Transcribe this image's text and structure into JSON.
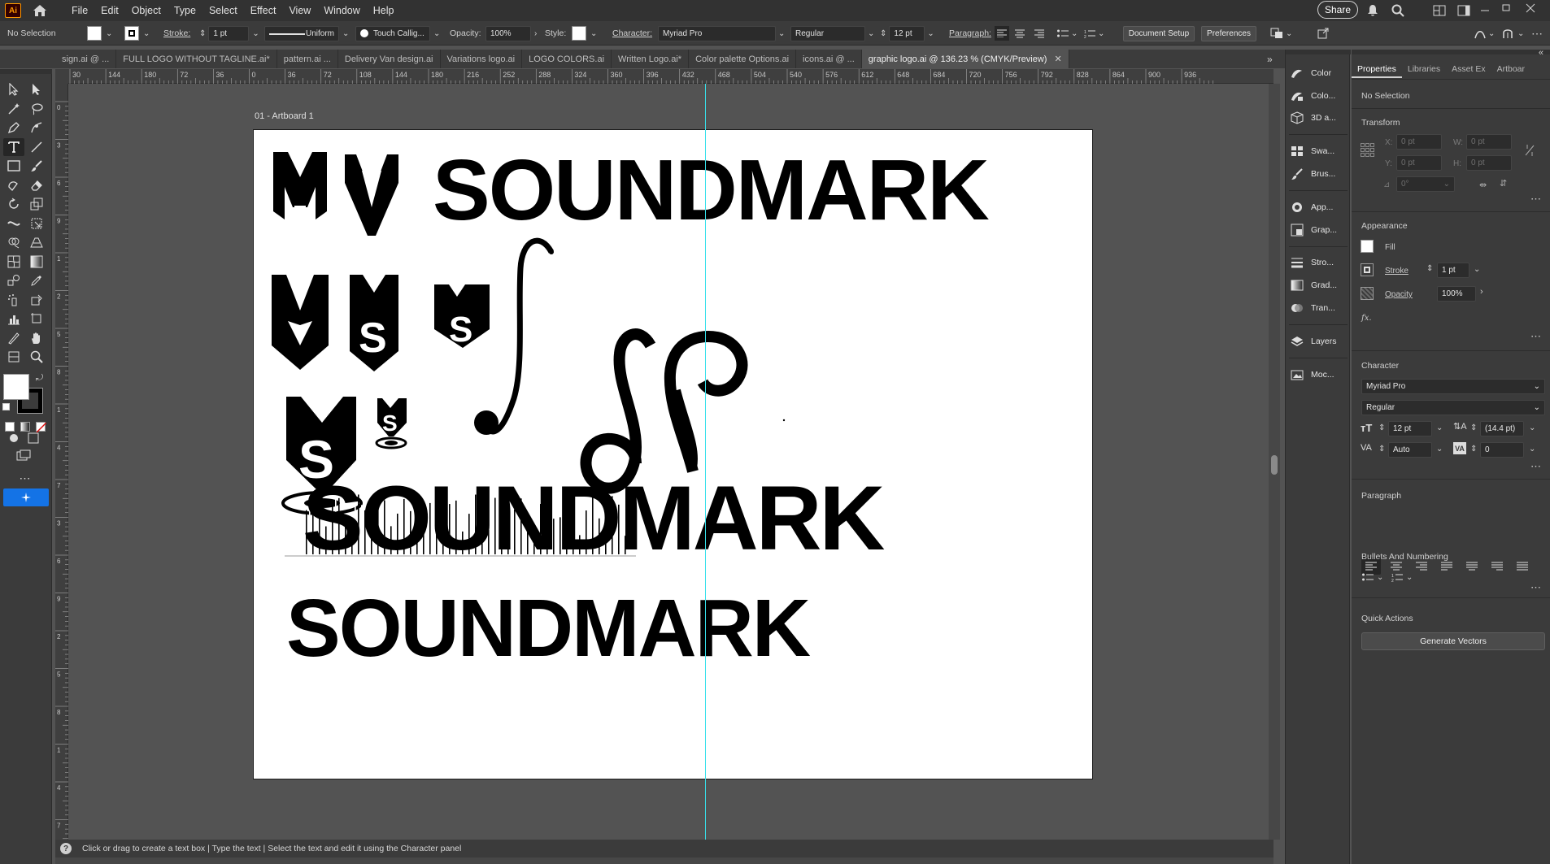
{
  "app": {
    "logo_text": "Ai",
    "menus": [
      "File",
      "Edit",
      "Object",
      "Type",
      "Select",
      "Effect",
      "View",
      "Window",
      "Help"
    ],
    "share_label": "Share"
  },
  "control_bar": {
    "selection": "No Selection",
    "stroke_label": "Stroke:",
    "stroke_weight": "1 pt",
    "stroke_profile": "Uniform",
    "brush": "Touch Callig...",
    "opacity_label": "Opacity:",
    "opacity": "100%",
    "style_label": "Style:",
    "character_label": "Character:",
    "font_family": "Myriad Pro",
    "font_style": "Regular",
    "font_size": "12 pt",
    "paragraph_label": "Paragraph:",
    "document_setup": "Document Setup",
    "preferences": "Preferences"
  },
  "tabs": [
    {
      "label": "sign.ai @ ...",
      "active": false
    },
    {
      "label": "FULL LOGO WITHOUT TAGLINE.ai*",
      "active": false
    },
    {
      "label": "pattern.ai ...",
      "active": false
    },
    {
      "label": "Delivery Van design.ai",
      "active": false
    },
    {
      "label": "Variations logo.ai",
      "active": false
    },
    {
      "label": "LOGO COLORS.ai",
      "active": false
    },
    {
      "label": "Written Logo.ai*",
      "active": false
    },
    {
      "label": "Color palette Options.ai",
      "active": false
    },
    {
      "label": "icons.ai @ ...",
      "active": false
    },
    {
      "label": "graphic logo.ai @ 136.23 % (CMYK/Preview)",
      "active": true
    }
  ],
  "ruler": {
    "h_ticks": [
      "30",
      "144",
      "180",
      "72",
      "36",
      "0",
      "36",
      "72",
      "108",
      "144",
      "180",
      "216",
      "252",
      "288",
      "324",
      "360",
      "396",
      "432",
      "468",
      "504",
      "540",
      "576",
      "612",
      "648",
      "684",
      "720",
      "756",
      "792",
      "828",
      "864",
      "900",
      "936"
    ],
    "v_ticks": [
      "0",
      "3",
      "6",
      "9",
      "1",
      "2",
      "5",
      "8",
      "1",
      "4",
      "7",
      "3",
      "6",
      "9",
      "2",
      "5",
      "8",
      "1",
      "4",
      "7"
    ]
  },
  "canvas": {
    "artboard_label": "01 - Artboard 1",
    "wordmark_text": "SOUNDMARK",
    "guide_color": "#38e0ea"
  },
  "status": {
    "help_icon": "?",
    "hint": "Click or drag to create a text box  |  Type the text  |  Select the text and edit it using the Character panel"
  },
  "dock": [
    {
      "icon": "color-icon",
      "label": "Color"
    },
    {
      "icon": "color-guide-icon",
      "label": "Colo..."
    },
    {
      "icon": "3d-icon",
      "label": "3D a..."
    },
    {
      "icon": "swatches-icon",
      "label": "Swa..."
    },
    {
      "icon": "brushes-icon",
      "label": "Brus..."
    },
    {
      "icon": "appearance-icon",
      "label": "App..."
    },
    {
      "icon": "graphic-styles-icon",
      "label": "Grap..."
    },
    {
      "icon": "stroke-icon",
      "label": "Stro..."
    },
    {
      "icon": "gradient-icon",
      "label": "Grad..."
    },
    {
      "icon": "transparency-icon",
      "label": "Tran..."
    },
    {
      "icon": "layers-icon",
      "label": "Layers"
    },
    {
      "icon": "mockup-icon",
      "label": "Moc..."
    }
  ],
  "properties": {
    "tabs": [
      "Properties",
      "Libraries",
      "Asset Ex",
      "Artboar"
    ],
    "selection": "No Selection",
    "transform_title": "Transform",
    "x_label": "X:",
    "x_value": "0 pt",
    "y_label": "Y:",
    "y_value": "0 pt",
    "w_label": "W:",
    "w_value": "0 pt",
    "h_label": "H:",
    "h_value": "0 pt",
    "angle_value": "0°",
    "appearance_title": "Appearance",
    "fill_label": "Fill",
    "stroke_label": "Stroke",
    "stroke_value": "1 pt",
    "opacity_label": "Opacity",
    "opacity_value": "100%",
    "fx_label": "fx.",
    "character_title": "Character",
    "font_family": "Myriad Pro",
    "font_style": "Regular",
    "font_size": "12 pt",
    "leading": "(14.4 pt)",
    "kerning": "Auto",
    "tracking": "0",
    "paragraph_title": "Paragraph",
    "bullets_title": "Bullets And Numbering",
    "quick_actions_title": "Quick Actions",
    "generate_vectors": "Generate Vectors"
  }
}
